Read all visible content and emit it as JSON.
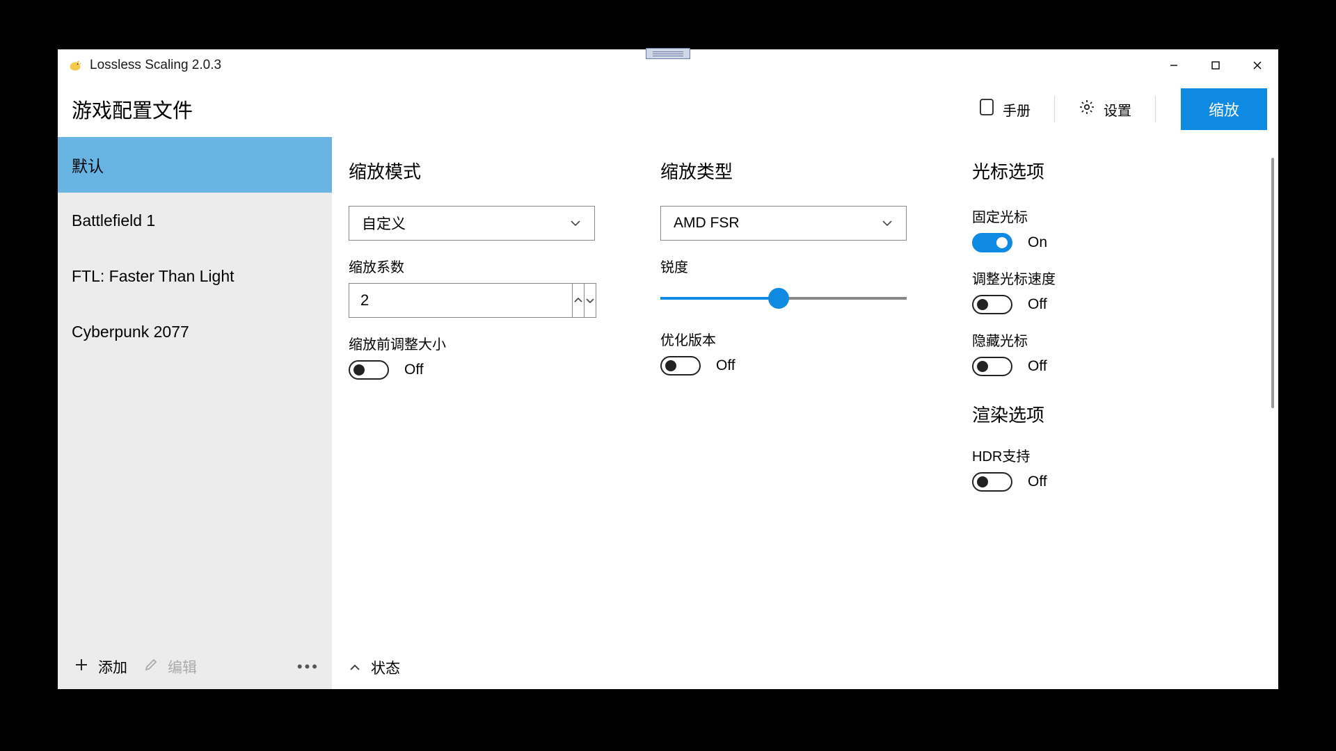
{
  "window": {
    "title": "Lossless Scaling 2.0.3"
  },
  "header": {
    "title": "游戏配置文件",
    "manual_label": "手册",
    "settings_label": "设置",
    "scale_button": "缩放"
  },
  "sidebar": {
    "profiles": [
      {
        "label": "默认",
        "active": true
      },
      {
        "label": "Battlefield 1",
        "active": false
      },
      {
        "label": "FTL: Faster Than Light",
        "active": false
      },
      {
        "label": "Cyberpunk 2077",
        "active": false
      }
    ],
    "add_label": "添加",
    "edit_label": "编辑"
  },
  "panels": {
    "scaling_mode": {
      "title": "缩放模式",
      "mode_value": "自定义",
      "factor_label": "缩放系数",
      "factor_value": "2",
      "resize_before_label": "缩放前调整大小",
      "resize_before_state": "Off"
    },
    "scaling_type": {
      "title": "缩放类型",
      "type_value": "AMD FSR",
      "sharpness_label": "锐度",
      "sharpness_percent": 48,
      "optimized_label": "优化版本",
      "optimized_state": "Off"
    },
    "cursor": {
      "title": "光标选项",
      "lock_label": "固定光标",
      "lock_state": "On",
      "adjust_speed_label": "调整光标速度",
      "adjust_speed_state": "Off",
      "hide_label": "隐藏光标",
      "hide_state": "Off"
    },
    "rendering": {
      "title": "渲染选项",
      "hdr_label": "HDR支持",
      "hdr_state": "Off"
    }
  },
  "status": {
    "label": "状态"
  }
}
